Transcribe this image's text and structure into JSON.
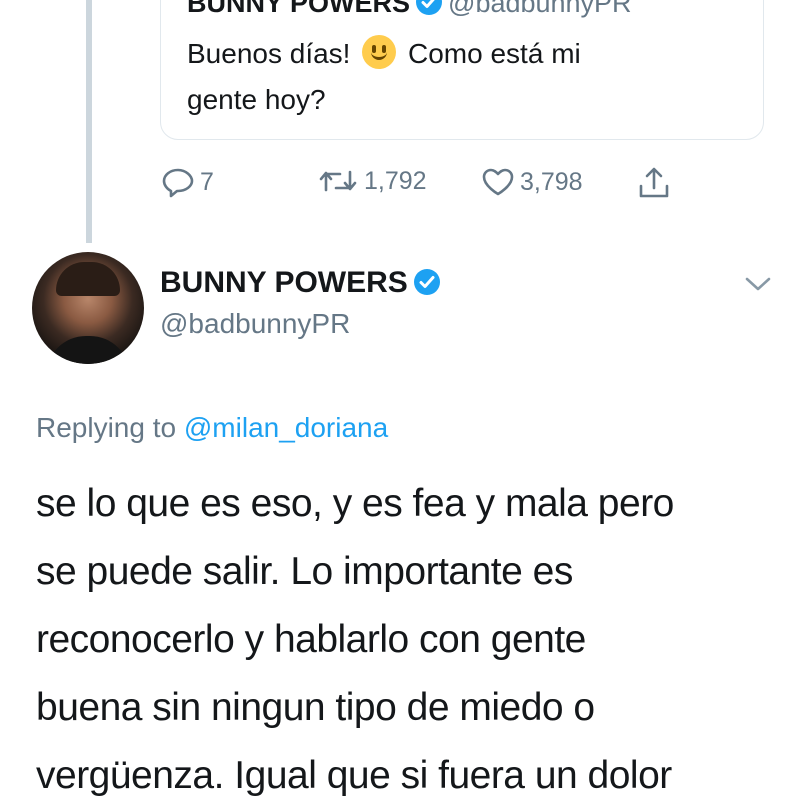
{
  "quoted_tweet": {
    "author_name": "BUNNY POWERS",
    "author_handle": "@badbunnyPR",
    "text_before_emoji": "Buenos días!",
    "emoji": "slightly-smiling-face",
    "text_after_emoji": "Como está mi",
    "text_line2": "gente hoy?"
  },
  "actions": {
    "reply_count": "7",
    "retweet_count": "1,792",
    "like_count": "3,798"
  },
  "tweet": {
    "author_name": "BUNNY POWERS",
    "author_handle": "@badbunnyPR",
    "replying_prefix": "Replying to",
    "replying_handle": "@milan_doriana",
    "lines": [
      "se lo que es eso, y es fea y mala pero",
      "se puede salir. Lo importante es",
      "reconocerlo y hablarlo con gente",
      "buena sin ningun tipo de miedo o",
      "vergüenza. Igual que si fuera un dolor"
    ]
  },
  "colors": {
    "accent": "#1da1f2",
    "secondary_text": "#657786",
    "thread_line": "#ccd6dd"
  },
  "icons": [
    "reply-icon",
    "retweet-icon",
    "like-icon",
    "share-icon",
    "verified-badge-icon",
    "chevron-down-icon"
  ]
}
